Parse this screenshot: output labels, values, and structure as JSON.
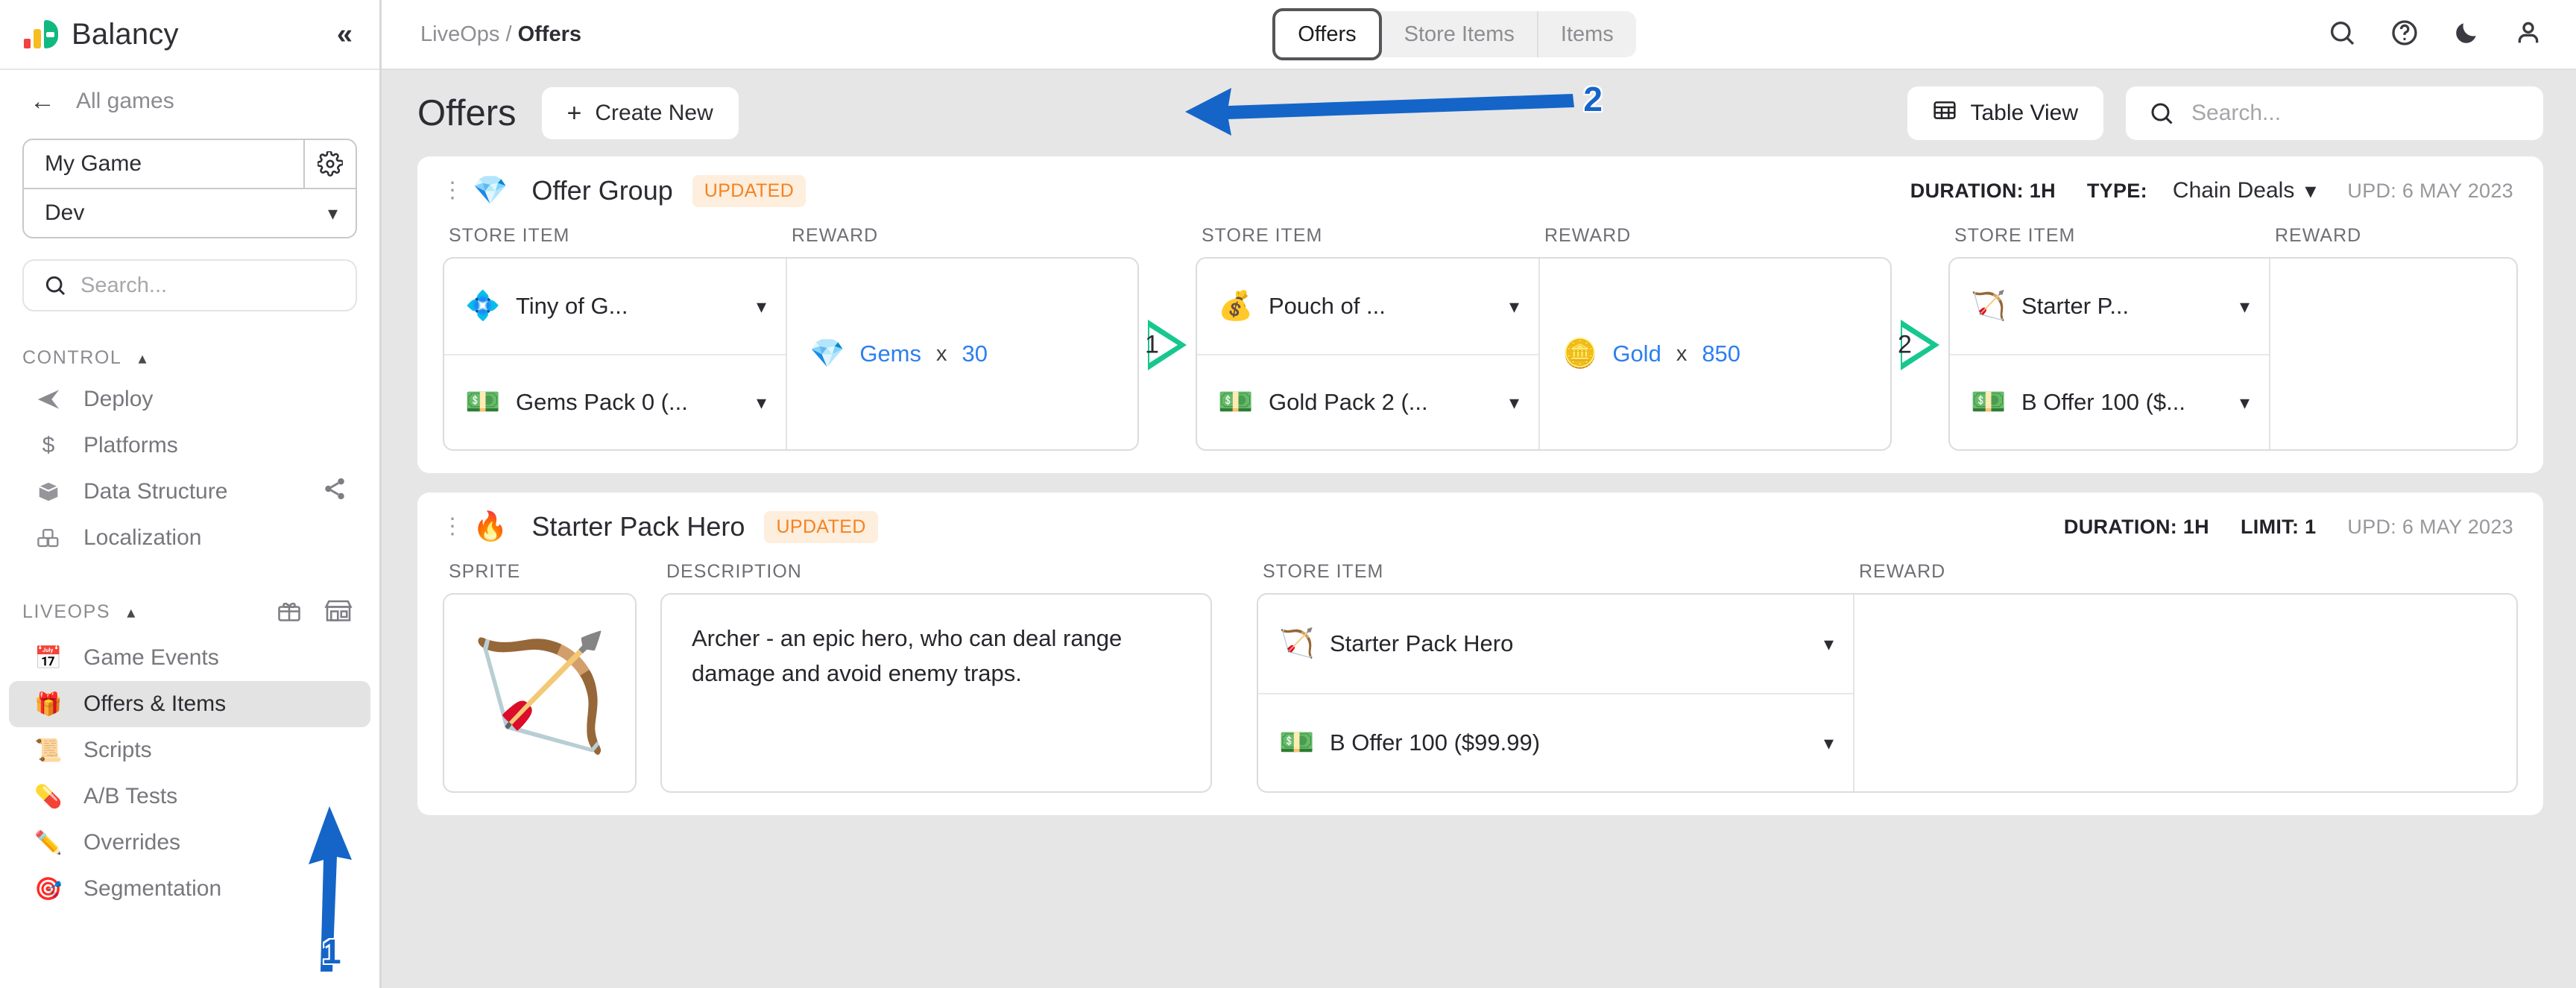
{
  "sidebar": {
    "brand": "Balancy",
    "collapse_icon": "double-chevron-left-icon",
    "back_label": "All games",
    "game_name": "My Game",
    "environment": "Dev",
    "search_placeholder": "Search...",
    "sections": [
      {
        "title": "CONTROL",
        "items": [
          {
            "label": "Deploy",
            "icon": "paper-plane-icon"
          },
          {
            "label": "Platforms",
            "icon": "dollar-icon"
          },
          {
            "label": "Data Structure",
            "icon": "box-icon",
            "trailing_icon": "share-icon"
          },
          {
            "label": "Localization",
            "icon": "blocks-icon"
          }
        ]
      },
      {
        "title": "LIVEOPS",
        "header_icons": [
          "gift-icon",
          "store-icon"
        ],
        "items": [
          {
            "label": "Game Events",
            "icon": "📅"
          },
          {
            "label": "Offers & Items",
            "icon": "🎁",
            "active": true
          },
          {
            "label": "Scripts",
            "icon": "📜"
          },
          {
            "label": "A/B Tests",
            "icon": "💊"
          },
          {
            "label": "Overrides",
            "icon": "✏️"
          },
          {
            "label": "Segmentation",
            "icon": "🎯"
          }
        ]
      }
    ]
  },
  "topbar": {
    "breadcrumb_root": "LiveOps",
    "breadcrumb_sep": "/",
    "breadcrumb_current": "Offers",
    "tabs": [
      {
        "label": "Offers",
        "active": true
      },
      {
        "label": "Store Items",
        "active": false
      },
      {
        "label": "Items",
        "active": false
      }
    ],
    "icons": [
      "search-icon",
      "help-circle-icon",
      "dark-mode-moon-icon",
      "user-account-icon"
    ]
  },
  "page": {
    "title": "Offers",
    "create_label": "Create New",
    "create_plus": "+",
    "table_view_label": "Table View",
    "search_placeholder": "Search..."
  },
  "annotations": [
    {
      "number": "1",
      "target": "Offers & Items sidebar item",
      "color": "#1565c8"
    },
    {
      "number": "2",
      "target": "Create New button",
      "color": "#1565c8"
    }
  ],
  "cards": [
    {
      "icon": "💎",
      "title": "Offer Group",
      "badge": "UPDATED",
      "duration_label": "DURATION: 1H",
      "type_label": "TYPE:",
      "type_value": "Chain Deals",
      "updated_label": "UPD: 6 MAY 2023",
      "col_store_item": "STORE ITEM",
      "col_reward": "REWARD",
      "chain": [
        {
          "store_items": [
            {
              "icon": "💠",
              "label": "Tiny of G..."
            },
            {
              "icon": "💵",
              "label": "Gems Pack 0 (..."
            }
          ],
          "reward": {
            "icon": "💎",
            "name": "Gems",
            "x": "x",
            "qty": "30"
          },
          "arrow_number": "1"
        },
        {
          "store_items": [
            {
              "icon": "💰",
              "label": "Pouch of ..."
            },
            {
              "icon": "💵",
              "label": "Gold Pack 2 (..."
            }
          ],
          "reward": {
            "icon": "🪙",
            "name": "Gold",
            "x": "x",
            "qty": "850"
          },
          "arrow_number": "2"
        },
        {
          "store_items": [
            {
              "icon": "🏹",
              "label": "Starter P..."
            },
            {
              "icon": "💵",
              "label": "B Offer 100 ($..."
            }
          ],
          "reward": null,
          "arrow_number": null
        }
      ]
    },
    {
      "icon": "🔥",
      "title": "Starter Pack Hero",
      "badge": "UPDATED",
      "duration_label": "DURATION: 1H",
      "limit_label": "LIMIT: 1",
      "updated_label": "UPD: 6 MAY 2023",
      "col_sprite": "SPRITE",
      "col_description": "DESCRIPTION",
      "col_store_item": "STORE ITEM",
      "col_reward": "REWARD",
      "sprite_icon": "🏹",
      "description": "Archer - an epic hero, who can deal range damage and avoid enemy traps.",
      "store_items": [
        {
          "icon": "🏹",
          "label": "Starter Pack Hero"
        },
        {
          "icon": "💵",
          "label": "B Offer 100 ($99.99)"
        }
      ]
    }
  ],
  "colors": {
    "accent_blue": "#2d7ff0",
    "badge_orange": "#f58220",
    "chain_green": "#17c78f",
    "annotation_blue": "#1565c8"
  }
}
